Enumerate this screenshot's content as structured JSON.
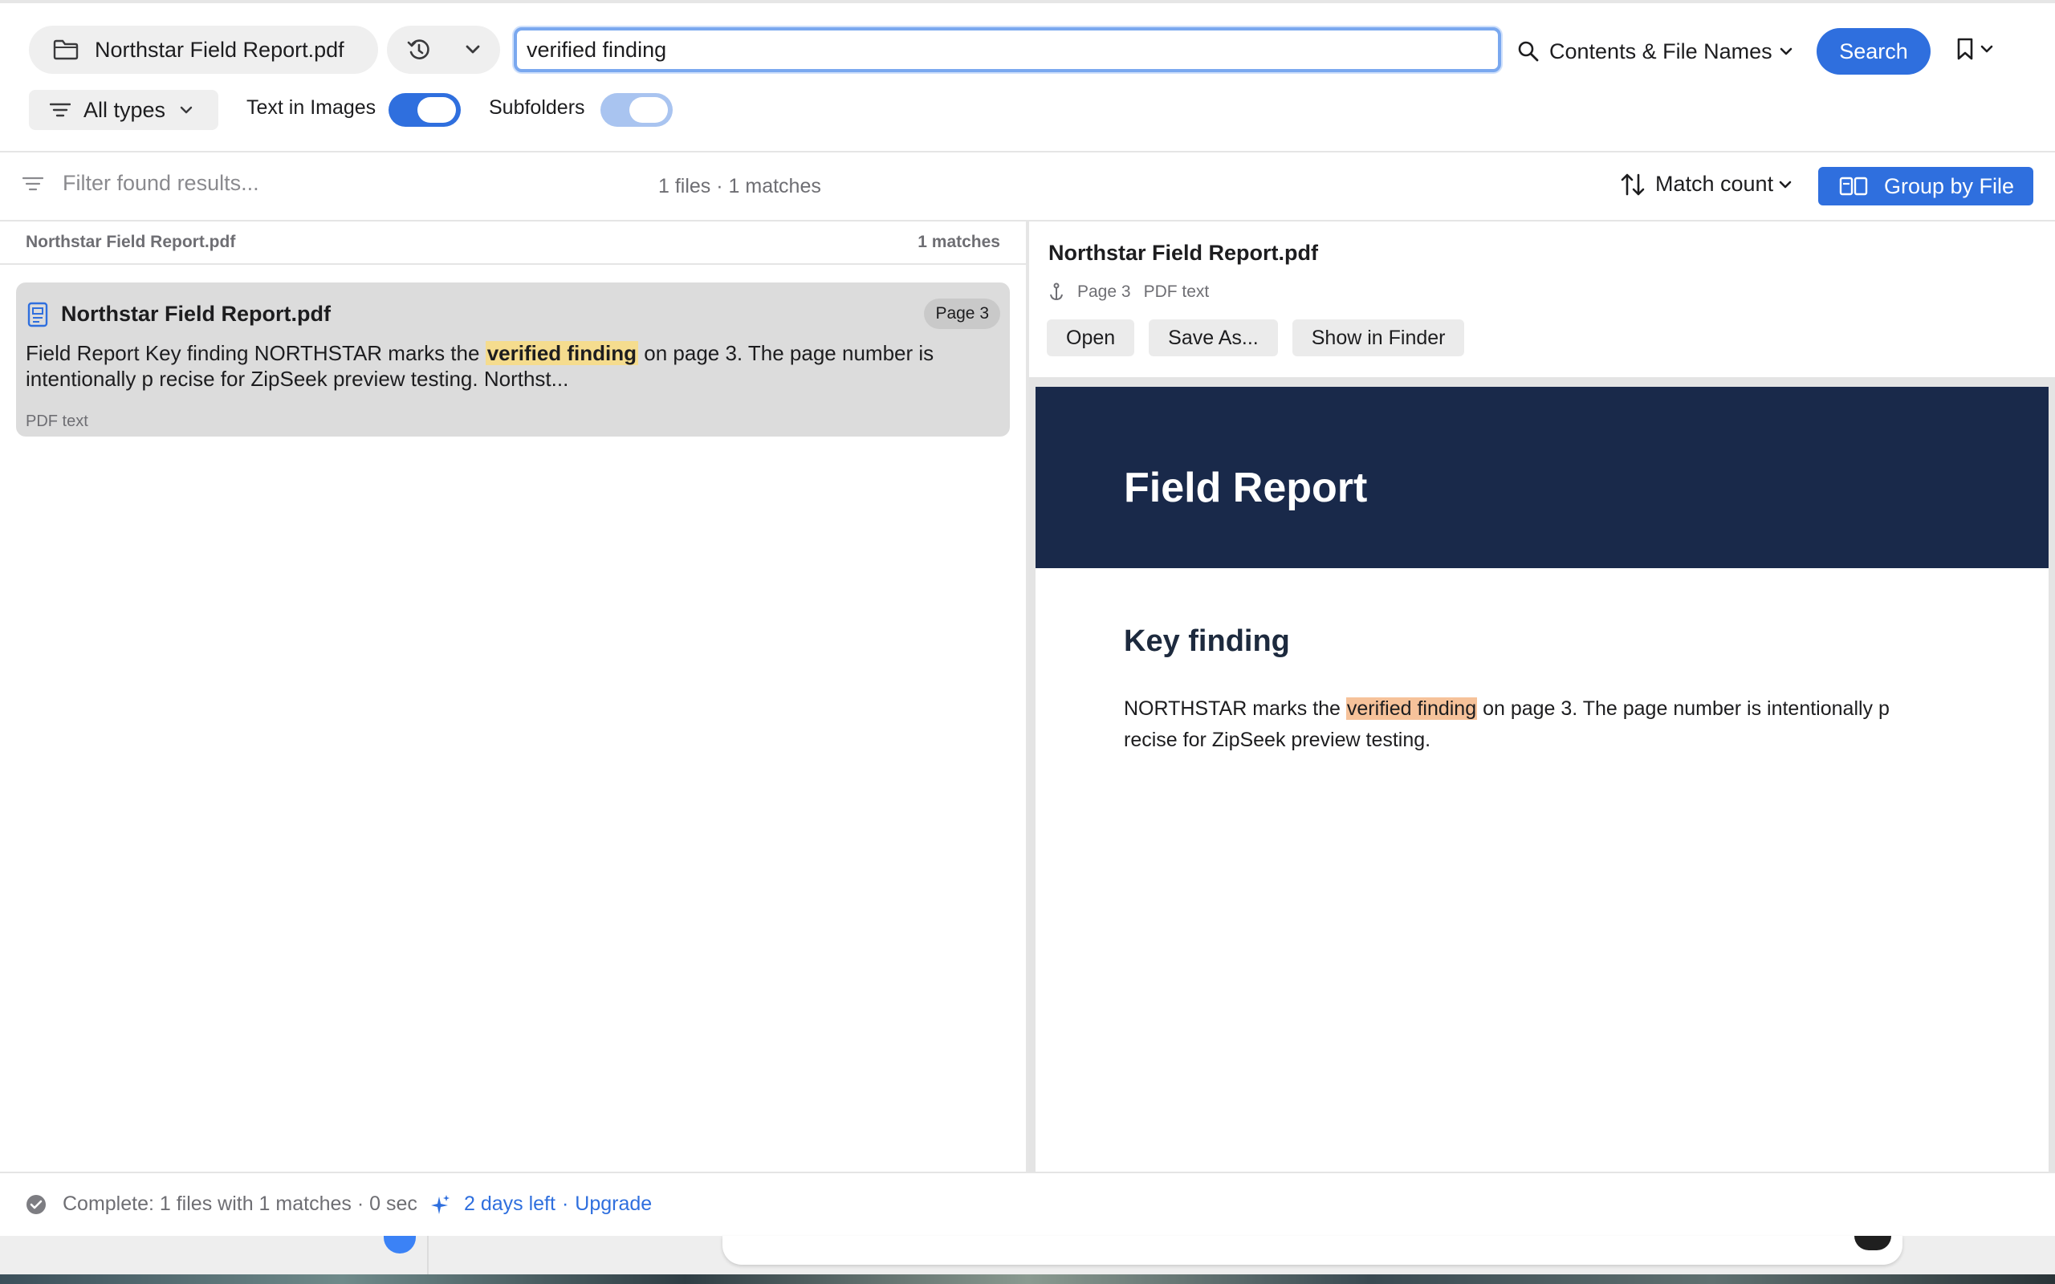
{
  "toolbar": {
    "folder_label": "Northstar Field Report.pdf",
    "search_value": "verified finding",
    "scope_label": "Contents & File Names",
    "search_button": "Search",
    "all_types_label": "All types",
    "text_in_images_label": "Text in Images",
    "text_in_images_on": true,
    "subfolders_label": "Subfolders",
    "subfolders_on": true
  },
  "results_bar": {
    "filter_placeholder": "Filter found results...",
    "summary": "1 files · 1 matches",
    "sort_label": "Match count",
    "group_label": "Group by File"
  },
  "results": {
    "group_name": "Northstar Field Report.pdf",
    "group_count": "1 matches",
    "items": [
      {
        "title": "Northstar Field Report.pdf",
        "page_badge": "Page 3",
        "snippet_before": "Field Report Key finding NORTHSTAR marks the ",
        "snippet_match": "verified finding",
        "snippet_after": " on page 3. The page number is intentionally p recise for ZipSeek preview testing. Northst...",
        "kind": "PDF text"
      }
    ]
  },
  "preview": {
    "title": "Northstar Field Report.pdf",
    "page": "Page 3",
    "kind": "PDF text",
    "actions": [
      "Open",
      "Save As...",
      "Show in Finder"
    ],
    "doc": {
      "banner_title": "Field Report",
      "heading": "Key finding",
      "body_before": "NORTHSTAR marks the ",
      "body_match": "verified finding",
      "body_after": " on page 3. The page number is intentionally p recise for ZipSeek preview testing."
    }
  },
  "status": {
    "complete_text": "Complete: 1 files with 1 matches · 0 sec",
    "trial_text": "2 days left",
    "separator": "·",
    "upgrade_text": "Upgrade"
  },
  "colors": {
    "accent": "#2f6fde",
    "match_highlight_list": "#f5dc8e",
    "match_highlight_preview": "#f6c29a",
    "doc_banner": "#19294a"
  },
  "icons": [
    "folder-icon",
    "history-icon",
    "chevron-down-icon",
    "magnifier-icon",
    "bookmark-icon",
    "filter-lines-icon",
    "sort-arrows-icon",
    "group-icon",
    "pdf-document-icon",
    "page-anchor-icon",
    "check-circle-icon",
    "sparkle-icon"
  ]
}
